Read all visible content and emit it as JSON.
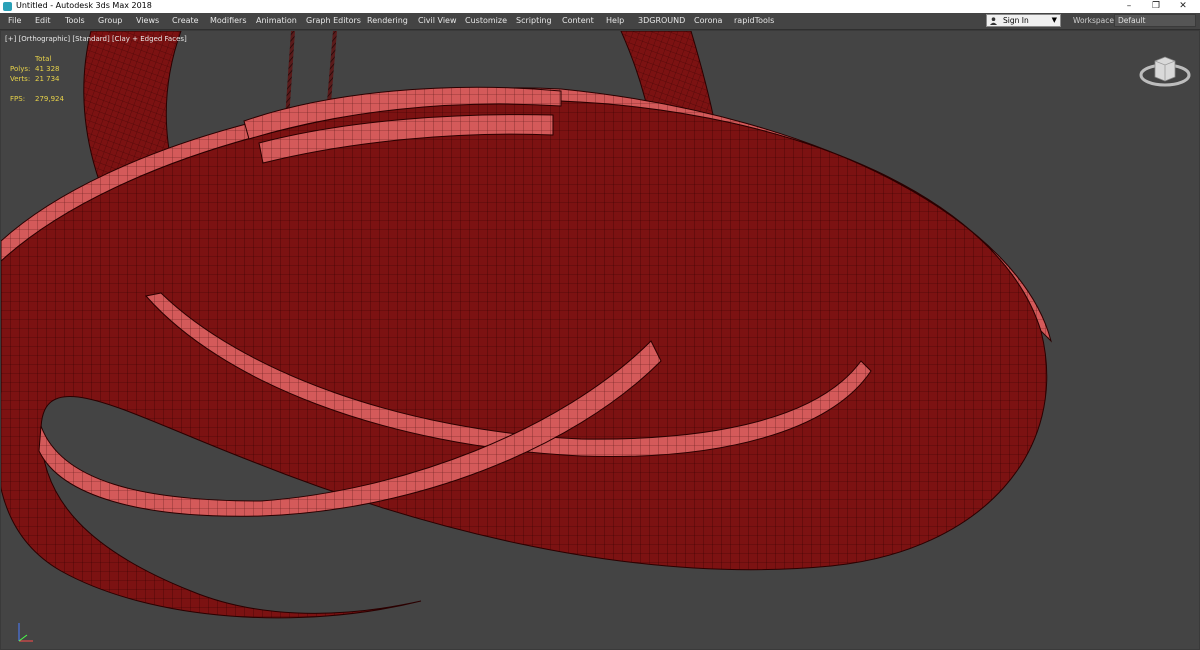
{
  "window": {
    "title": "Untitled - Autodesk 3ds Max 2018"
  },
  "menu": [
    "File",
    "Edit",
    "Tools",
    "Group",
    "Views",
    "Create",
    "Modifiers",
    "Animation",
    "Graph Editors",
    "Rendering",
    "Civil View",
    "Customize",
    "Scripting",
    "Content",
    "Help",
    "3DGROUND",
    "Corona",
    "rapidTools"
  ],
  "account": {
    "signin_label": "Sign In"
  },
  "workspace": {
    "label": "Workspaces:",
    "value": "Default"
  },
  "viewport": {
    "labels": [
      "[+]",
      "[Orthographic]",
      "[Standard]",
      "[Clay + Edged Faces]"
    ],
    "stats": {
      "header": "Total",
      "polys_label": "Polys:",
      "polys_value": "41 328",
      "verts_label": "Verts:",
      "verts_value": "21 734",
      "fps_label": "FPS:",
      "fps_value": "279,924"
    }
  },
  "icons": {
    "app": "3ds-max-logo-icon",
    "minimize": "minimize-icon",
    "maximize": "restore-icon",
    "close": "close-icon",
    "viewcube": "viewcube-icon",
    "axis": "axis-tripod-icon"
  },
  "colors": {
    "viewport_bg": "#444444",
    "model_fill": "#7c1212",
    "model_top": "#d45a5a",
    "wire": "#2a0000",
    "stats_text": "#e7d24a"
  }
}
